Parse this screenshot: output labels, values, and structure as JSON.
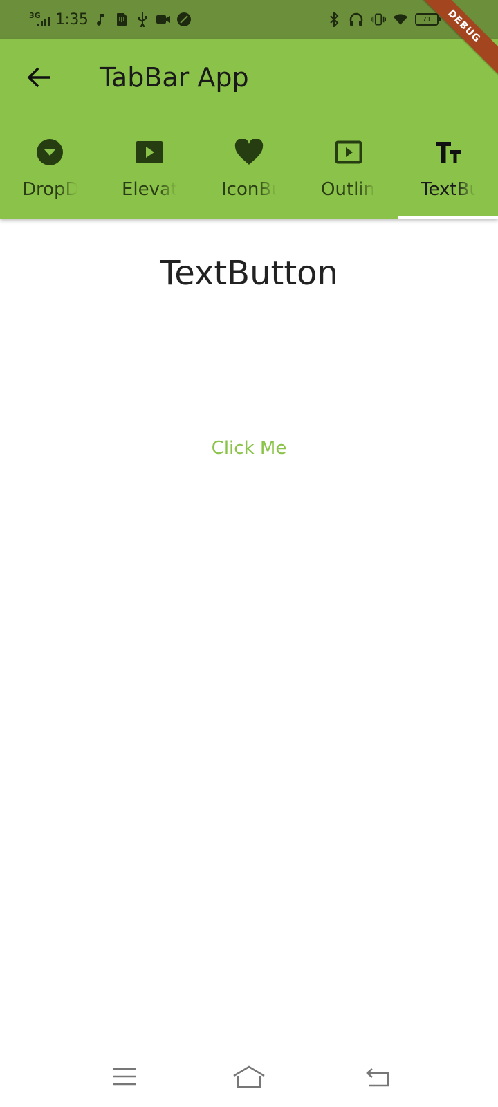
{
  "status_bar": {
    "network": "3G",
    "time": "1:35",
    "battery_level": "71"
  },
  "debug_banner": "DEBUG",
  "app_bar": {
    "title": "TabBar App",
    "background_color": "#8bc34a"
  },
  "tabs": [
    {
      "label": "DropDown",
      "icon": "arrow-drop-down-circle-icon",
      "selected": false
    },
    {
      "label": "ElevatedButton",
      "icon": "play-box-icon",
      "selected": false
    },
    {
      "label": "IconButton",
      "icon": "heart-icon",
      "selected": false
    },
    {
      "label": "OutlinedButton",
      "icon": "play-box-outline-icon",
      "selected": false
    },
    {
      "label": "TextButton",
      "icon": "text-fields-icon",
      "selected": true
    }
  ],
  "content": {
    "title": "TextButton",
    "button_label": "Click Me",
    "button_color": "#8bc34a"
  }
}
